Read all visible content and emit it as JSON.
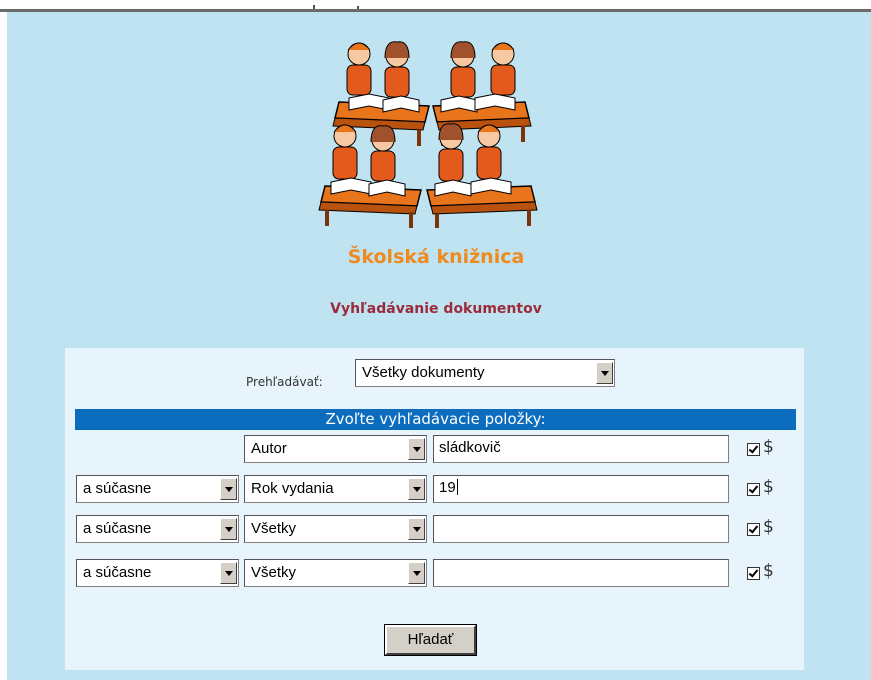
{
  "header": {
    "library_title": "Školská knižnica",
    "search_title": "Vyhľadávanie dokumentov"
  },
  "search": {
    "scope_label": "Prehľadávať:",
    "scope_value": "Všetky dokumenty",
    "fields_header": "Zvoľte vyhľadávacie položky:",
    "rows": [
      {
        "operator": "",
        "field": "Autor",
        "value": "sládkovič",
        "checked": true,
        "dollar": "$"
      },
      {
        "operator": "a súčasne",
        "field": "Rok vydania",
        "value": "19",
        "checked": true,
        "dollar": "$"
      },
      {
        "operator": "a súčasne",
        "field": "Všetky",
        "value": "",
        "checked": true,
        "dollar": "$"
      },
      {
        "operator": "a súčasne",
        "field": "Všetky",
        "value": "",
        "checked": true,
        "dollar": "$"
      }
    ],
    "submit_label": "Hľadať"
  },
  "colors": {
    "page_bg": "#bfe3f1",
    "panel_bg": "#e8f4fb",
    "header_bar": "#0c6dbf",
    "library_title": "#ef8a1e",
    "search_title": "#9b2b3a"
  },
  "logo": {
    "icon": "students-reading-at-desks-icon"
  }
}
